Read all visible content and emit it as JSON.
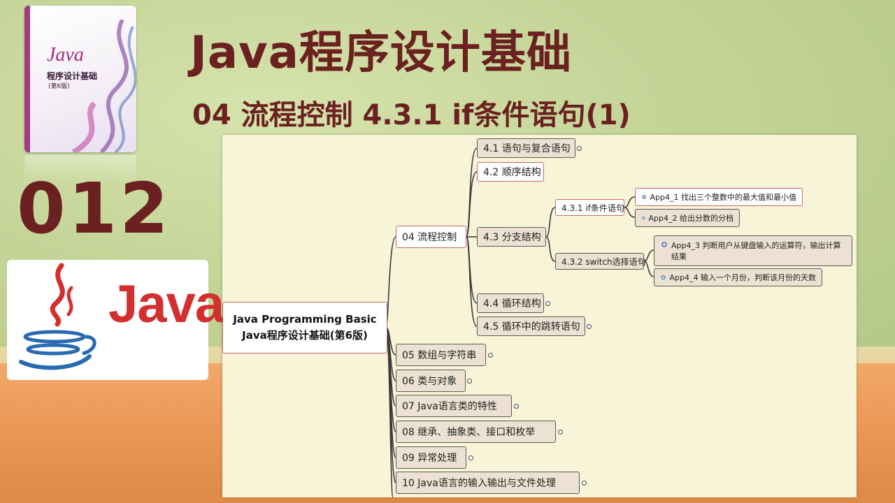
{
  "header": {
    "title": "Java程序设计基础",
    "subtitle": "04 流程控制  4.3.1 if条件语句(1)",
    "lesson_number": "012"
  },
  "book": {
    "brand": "Java",
    "title": "程序设计基础",
    "edition": "(第6版)"
  },
  "logo": {
    "text": "Java"
  },
  "mindmap": {
    "root_line1": "Java Programming Basic",
    "root_line2": "Java程序设计基础(第6版)",
    "chapters": [
      "04 流程控制",
      "05 数组与字符串",
      "06 类与对象",
      "07 Java语言类的特性",
      "08 继承、抽象类、接口和枚举",
      "09 异常处理",
      "10 Java语言的输入输出与文件处理"
    ],
    "sections": [
      "4.1 语句与复合语句",
      "4.2 顺序结构",
      "4.3 分支结构",
      "4.4 循环结构",
      "4.5 循环中的跳转语句"
    ],
    "subsections": [
      "4.3.1 if条件语句",
      "4.3.2 switch选择语句"
    ],
    "apps": [
      "App4_1 找出三个整数中的最大值和最小值",
      "App4_2 给出分数的分档",
      "App4_3 判断用户从键盘输入的运算符，输出计算",
      "结果",
      "App4_4 输入一个月份，判断该月份的天数"
    ]
  },
  "colors": {
    "title": "#6b2120",
    "java_red": "#d42f2f",
    "java_blue": "#2a6ab0",
    "node_fill": "#ece1d2",
    "selected_border": "#c86868"
  }
}
